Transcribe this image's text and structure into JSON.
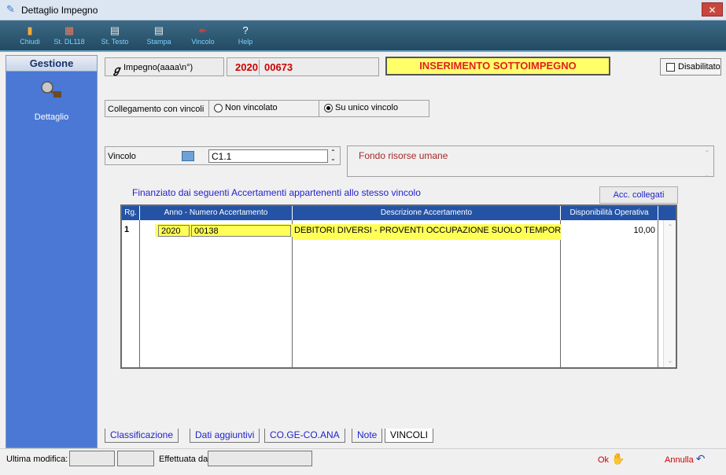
{
  "window": {
    "title": "Dettaglio Impegno",
    "close_glyph": "✕"
  },
  "toolbar": [
    {
      "label": "Chiudi",
      "icon": "exit-icon",
      "glyph": "▮",
      "color": "#f7a83a"
    },
    {
      "label": "St. DL118",
      "icon": "report-icon",
      "glyph": "▦",
      "color": "#f7a83a"
    },
    {
      "label": "St. Testo",
      "icon": "print-text-icon",
      "glyph": "▤",
      "color": "#9ad0f0"
    },
    {
      "label": "Stampa",
      "icon": "print-icon",
      "glyph": "▤",
      "color": "#9ad0f0"
    },
    {
      "label": "Vincolo",
      "icon": "link-icon",
      "glyph": "↞",
      "color": "#9ad0f0"
    },
    {
      "label": "Help",
      "icon": "help-icon",
      "glyph": "?",
      "color": "#9ad0f0"
    }
  ],
  "sidebar": {
    "title": "Gestione",
    "item_label": "Dettaglio"
  },
  "header": {
    "impegno_label": "Impegno(aaaa\\n°)",
    "year": "2020",
    "number": "00673",
    "mode": "INSERIMENTO SOTTOIMPEGNO",
    "disabilitato_label": "Disabilitato",
    "disabilitato_checked": false
  },
  "collegamento": {
    "label": "Collegamento con vincoli",
    "options": [
      {
        "label": "Non vincolato",
        "selected": false
      },
      {
        "label": "Su unico vincolo",
        "selected": true
      }
    ]
  },
  "vincolo": {
    "label": "Vincolo",
    "code": "C1.1",
    "description": "Fondo risorse umane"
  },
  "financed_title": "Finanziato dai seguenti Accertamenti appartenenti allo stesso vincolo",
  "acc_collegati_label": "Acc. collegati",
  "grid": {
    "headers": [
      "Rg.",
      "Anno - Numero Accertamento",
      "Descrizione Accertamento",
      "Disponibilità Operativa"
    ],
    "rows": [
      {
        "rg": "1",
        "anno": "2020",
        "numero": "00138",
        "descrizione": "DEBITORI DIVERSI - PROVENTI OCCUPAZIONE SUOLO TEMPORANE",
        "disponibilita": "10,00"
      }
    ]
  },
  "tabs": [
    {
      "label": "Classificazione",
      "active": false
    },
    {
      "label": "Dati aggiuntivi",
      "active": false
    },
    {
      "label": "CO.GE-CO.ANA",
      "active": false
    },
    {
      "label": "Note",
      "active": false
    },
    {
      "label": "VINCOLI",
      "active": true
    }
  ],
  "status": {
    "ultima_modifica_label": "Ultima modifica:",
    "effettuata_label": "Effettuata da:",
    "ok_label": "Ok",
    "annulla_label": "Annulla"
  }
}
